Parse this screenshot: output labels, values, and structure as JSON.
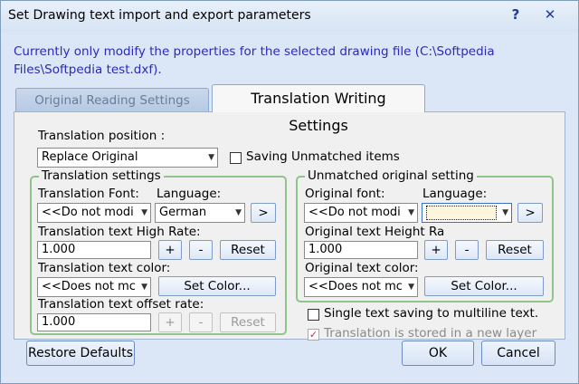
{
  "window": {
    "title": "Set Drawing text import and export parameters",
    "help_label": "?",
    "close_label": "✕",
    "info": "Currently only modify the properties for the selected drawing file (C:\\Softpedia Files\\Softpedia test.dxf)."
  },
  "tabs": [
    {
      "label": "Original Reading Settings",
      "active": false
    },
    {
      "label": "Translation Writing Settings",
      "active": true
    }
  ],
  "translation_position": {
    "label": "Translation position :",
    "value": "Replace Original",
    "saving_unmatched_label": "Saving Unmatched items",
    "saving_unmatched_checked": false
  },
  "translation_settings": {
    "title": "Translation settings",
    "font_label": "Translation Font:",
    "font_value": "<<Do not modi",
    "language_label": "Language:",
    "language_value": "German",
    "next_label": ">",
    "high_rate_label": "Translation text High Rate:",
    "high_rate_value": "1.000",
    "plus_label": "+",
    "minus_label": "-",
    "reset_label": "Reset",
    "color_label": "Translation text color:",
    "color_value": "<<Does not mc",
    "set_color_label": "Set Color...",
    "offset_label": "Translation text offset rate:",
    "offset_value": "1.000",
    "offset_plus_label": "+",
    "offset_minus_label": "-",
    "offset_reset_label": "Reset"
  },
  "unmatched_settings": {
    "title": "Unmatched original setting",
    "font_label": "Original font:",
    "font_value": "<<Do not modi",
    "language_label": "Language:",
    "language_value": "",
    "next_label": ">",
    "height_label": "Original text Height Ra",
    "height_value": "1.000",
    "plus_label": "+",
    "minus_label": "-",
    "reset_label": "Reset",
    "color_label": "Original text color:",
    "color_value": "<<Does not mc",
    "set_color_label": "Set Color..."
  },
  "options": {
    "single_text_label": "Single text saving to multiline text.",
    "single_text_checked": false,
    "new_layer_label": "Translation is stored in a new layer",
    "new_layer_checked": true,
    "new_layer_check_glyph": "✓"
  },
  "footer": {
    "restore_label": "Restore Defaults",
    "ok_label": "OK",
    "cancel_label": "Cancel"
  },
  "colors": {
    "accent_text": "#2a2ab8",
    "group_border": "#8fc48a",
    "window_bg": "#dbe7f6"
  }
}
